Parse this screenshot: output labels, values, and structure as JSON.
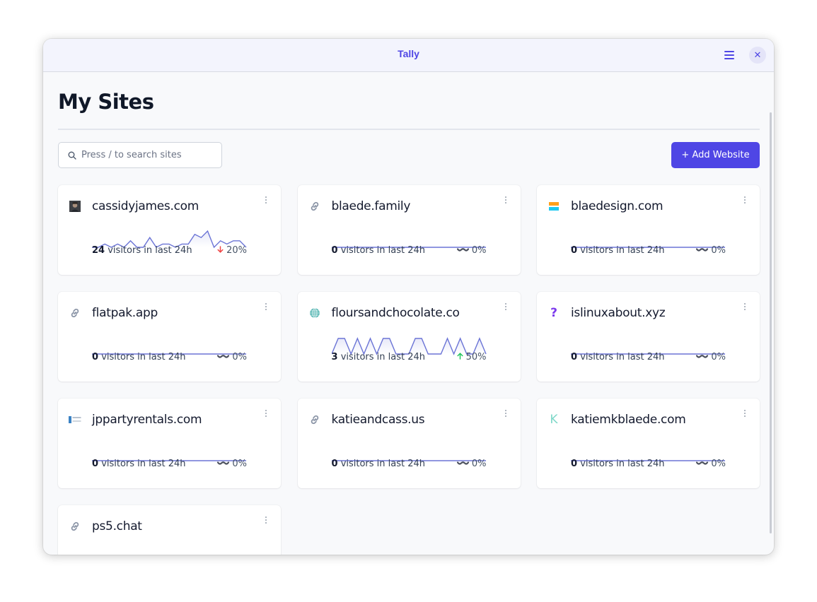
{
  "window": {
    "title": "Tally",
    "menu_icon": "hamburger-menu-icon",
    "close_icon": "close-icon",
    "close_glyph": "✕"
  },
  "page": {
    "title": "My Sites",
    "search": {
      "placeholder": "Press / to search sites",
      "value": "",
      "icon": "search-icon"
    },
    "add_button_label": "+ Add Website"
  },
  "colors": {
    "accent": "#4f46e5",
    "sparkline": "#6b74d6",
    "trend_down": "#ef4444",
    "trend_up": "#22c55e",
    "trend_flat": "#475467"
  },
  "visitors_suffix": "visitors in last 24h",
  "sites": [
    {
      "name": "cassidyjames.com",
      "favicon": "avatar-photo",
      "visitors": "24",
      "trend": "down",
      "change": "20%",
      "series": [
        0,
        0,
        1,
        0,
        1,
        0,
        2,
        0,
        0,
        3,
        0,
        1,
        1,
        0,
        1,
        1,
        4,
        3,
        5,
        0,
        2,
        1,
        2,
        2,
        0
      ]
    },
    {
      "name": "blaede.family",
      "favicon": "link",
      "visitors": "0",
      "trend": "flat",
      "change": "0%",
      "series": []
    },
    {
      "name": "blaedesign.com",
      "favicon": "blaedesign-logo",
      "visitors": "0",
      "trend": "flat",
      "change": "0%",
      "series": []
    },
    {
      "name": "flatpak.app",
      "favicon": "link",
      "visitors": "0",
      "trend": "flat",
      "change": "0%",
      "series": []
    },
    {
      "name": "floursandchocolate.co",
      "favicon": "globe-logo",
      "visitors": "3",
      "trend": "up",
      "change": "50%",
      "series": [
        0,
        1,
        1,
        0,
        1,
        0,
        1,
        0,
        1,
        1,
        0,
        0,
        0,
        1,
        1,
        0,
        0,
        0,
        1,
        0,
        1,
        0,
        0,
        1,
        0
      ]
    },
    {
      "name": "islinuxabout.xyz",
      "favicon": "question",
      "visitors": "0",
      "trend": "flat",
      "change": "0%",
      "series": []
    },
    {
      "name": "jppartyrentals.com",
      "favicon": "jpparty-logo",
      "visitors": "0",
      "trend": "flat",
      "change": "0%",
      "series": []
    },
    {
      "name": "katieandcass.us",
      "favicon": "link",
      "visitors": "0",
      "trend": "flat",
      "change": "0%",
      "series": []
    },
    {
      "name": "katiemkblaede.com",
      "favicon": "k-letter",
      "visitors": "0",
      "trend": "flat",
      "change": "0%",
      "series": []
    },
    {
      "name": "ps5.chat",
      "favicon": "link",
      "visitors": null,
      "trend": null,
      "change": null,
      "series": null
    }
  ]
}
